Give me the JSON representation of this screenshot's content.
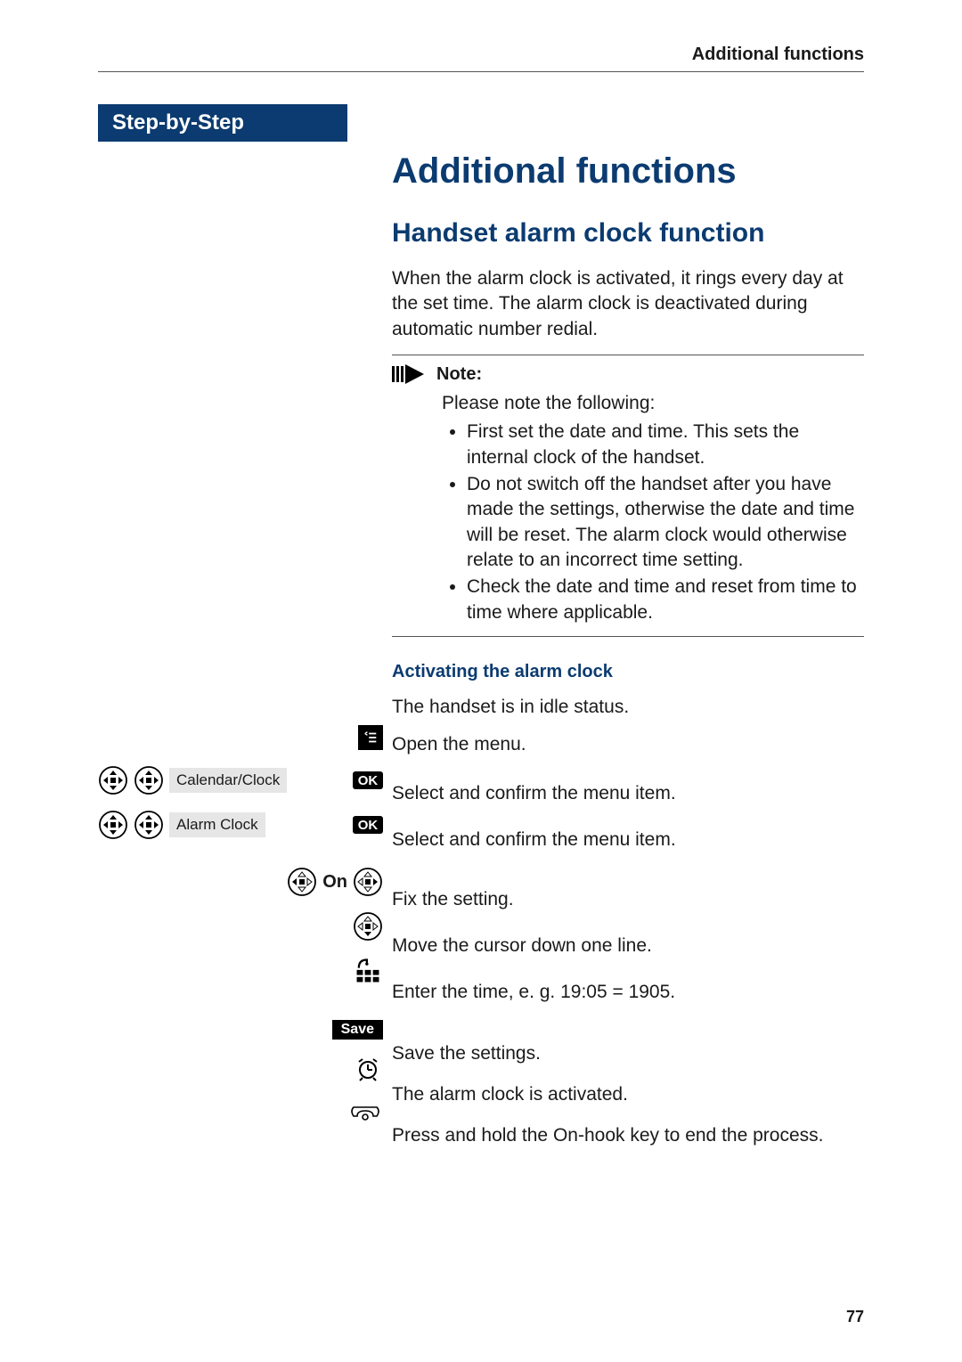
{
  "header": {
    "running": "Additional functions"
  },
  "sidebar": {
    "label": "Step-by-Step"
  },
  "title": "Additional functions",
  "subtitle": "Handset alarm clock function",
  "intro": "When the alarm clock is activated, it rings every day at the set time. The alarm clock is deactivated during automatic number redial.",
  "note": {
    "label": "Note:",
    "lead": "Please note the following:",
    "bullets": [
      "First set the date and time. This sets the internal clock of the handset.",
      "Do not switch off the handset after you have made the settings, otherwise the date and time will be reset. The alarm clock would otherwise relate to an incorrect time setting.",
      "Check the date and time and reset from time to time where applicable."
    ]
  },
  "activating": {
    "heading": "Activating the alarm clock",
    "idle": "The handset is in idle status.",
    "steps": [
      {
        "text": "Open the menu."
      },
      {
        "sideMenu": "Calendar/Clock",
        "text": "Select and confirm the menu item."
      },
      {
        "sideMenu": "Alarm Clock",
        "text": "Select and confirm the menu item."
      },
      {
        "on": "On",
        "text": "Fix the setting."
      },
      {
        "text": "Move the cursor down one line."
      },
      {
        "text": "Enter the time, e. g. 19:05 = 1905."
      },
      {
        "save": "Save",
        "text": "Save the settings."
      },
      {
        "text": "The alarm clock is activated."
      },
      {
        "text": "Press and hold the On-hook key to end the process."
      }
    ],
    "ok": "OK"
  },
  "pageNumber": "77"
}
